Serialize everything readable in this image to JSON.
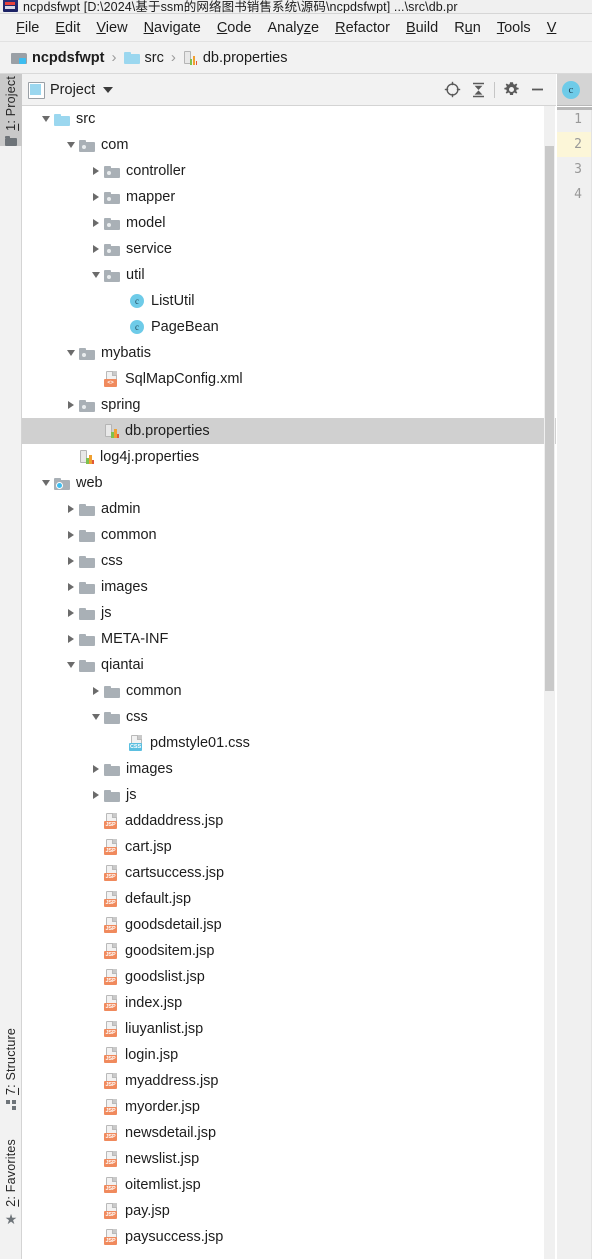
{
  "window": {
    "title": "ncpdsfwpt [D:\\2024\\基于ssm的网络图书销售系统\\源码\\ncpdsfwpt] ...\\src\\db.pr",
    "logo_icon": "intellij-idea-logo"
  },
  "menubar": {
    "items": [
      {
        "label": "File",
        "mnemonic": "F"
      },
      {
        "label": "Edit",
        "mnemonic": "E"
      },
      {
        "label": "View",
        "mnemonic": "V"
      },
      {
        "label": "Navigate",
        "mnemonic": "N"
      },
      {
        "label": "Code",
        "mnemonic": "C"
      },
      {
        "label": "Analyze",
        "mnemonic": "z"
      },
      {
        "label": "Refactor",
        "mnemonic": "R"
      },
      {
        "label": "Build",
        "mnemonic": "B"
      },
      {
        "label": "Run",
        "mnemonic": "u"
      },
      {
        "label": "Tools",
        "mnemonic": "T"
      },
      {
        "label": "V",
        "mnemonic": "V"
      }
    ]
  },
  "breadcrumb": {
    "separator": "›",
    "items": [
      {
        "label": "ncpdsfwpt",
        "icon": "module-icon",
        "bold": true
      },
      {
        "label": "src",
        "icon": "folder-blue-icon",
        "bold": false
      },
      {
        "label": "db.properties",
        "icon": "properties-file-icon",
        "bold": false
      }
    ]
  },
  "left_stripe": {
    "buttons": [
      {
        "label": "1: Project",
        "mnemonic": "1",
        "icon": "project-icon",
        "active": true
      },
      {
        "label": "7: Structure",
        "mnemonic": "7",
        "icon": "structure-icon",
        "active": false
      },
      {
        "label": "2: Favorites",
        "mnemonic": "2",
        "icon": "star-icon",
        "active": false
      }
    ]
  },
  "project_panel": {
    "title": "Project",
    "view_icon": "project-view-icon",
    "dropdown_icon": "chevron-down-icon",
    "toolbar": [
      {
        "name": "locate-icon",
        "tooltip": "Select Opened File"
      },
      {
        "name": "collapse-all-icon",
        "tooltip": "Collapse All"
      },
      {
        "name": "gear-icon",
        "tooltip": "Settings"
      },
      {
        "name": "minimize-icon",
        "tooltip": "Hide"
      }
    ],
    "tree": [
      {
        "label": "src",
        "depth": 1,
        "arrow": "down",
        "icon": "folder-blue-icon",
        "selected": false
      },
      {
        "label": "com",
        "depth": 2,
        "arrow": "down",
        "icon": "package-icon",
        "selected": false
      },
      {
        "label": "controller",
        "depth": 3,
        "arrow": "right",
        "icon": "package-icon",
        "selected": false
      },
      {
        "label": "mapper",
        "depth": 3,
        "arrow": "right",
        "icon": "package-icon",
        "selected": false
      },
      {
        "label": "model",
        "depth": 3,
        "arrow": "right",
        "icon": "package-icon",
        "selected": false
      },
      {
        "label": "service",
        "depth": 3,
        "arrow": "right",
        "icon": "package-icon",
        "selected": false
      },
      {
        "label": "util",
        "depth": 3,
        "arrow": "down",
        "icon": "package-icon",
        "selected": false
      },
      {
        "label": "ListUtil",
        "depth": 4,
        "arrow": "none",
        "icon": "java-class-icon",
        "selected": false
      },
      {
        "label": "PageBean",
        "depth": 4,
        "arrow": "none",
        "icon": "java-class-icon",
        "selected": false
      },
      {
        "label": "mybatis",
        "depth": 2,
        "arrow": "down",
        "icon": "package-icon",
        "selected": false
      },
      {
        "label": "SqlMapConfig.xml",
        "depth": 3,
        "arrow": "none",
        "icon": "xml-file-icon",
        "selected": false
      },
      {
        "label": "spring",
        "depth": 2,
        "arrow": "right",
        "icon": "package-icon",
        "selected": false
      },
      {
        "label": "db.properties",
        "depth": 3,
        "arrow": "none",
        "icon": "properties-file-icon",
        "selected": true
      },
      {
        "label": "log4j.properties",
        "depth": 2,
        "arrow": "none",
        "icon": "properties-file-icon",
        "selected": false
      },
      {
        "label": "web",
        "depth": 1,
        "arrow": "down",
        "icon": "web-root-icon",
        "selected": false
      },
      {
        "label": "admin",
        "depth": 2,
        "arrow": "right",
        "icon": "folder-icon",
        "selected": false
      },
      {
        "label": "common",
        "depth": 2,
        "arrow": "right",
        "icon": "folder-icon",
        "selected": false
      },
      {
        "label": "css",
        "depth": 2,
        "arrow": "right",
        "icon": "folder-icon",
        "selected": false
      },
      {
        "label": "images",
        "depth": 2,
        "arrow": "right",
        "icon": "folder-icon",
        "selected": false
      },
      {
        "label": "js",
        "depth": 2,
        "arrow": "right",
        "icon": "folder-icon",
        "selected": false
      },
      {
        "label": "META-INF",
        "depth": 2,
        "arrow": "right",
        "icon": "folder-icon",
        "selected": false
      },
      {
        "label": "qiantai",
        "depth": 2,
        "arrow": "down",
        "icon": "folder-icon",
        "selected": false
      },
      {
        "label": "common",
        "depth": 3,
        "arrow": "right",
        "icon": "folder-icon",
        "selected": false
      },
      {
        "label": "css",
        "depth": 3,
        "arrow": "down",
        "icon": "folder-icon",
        "selected": false
      },
      {
        "label": "pdmstyle01.css",
        "depth": 4,
        "arrow": "none",
        "icon": "css-file-icon",
        "selected": false
      },
      {
        "label": "images",
        "depth": 3,
        "arrow": "right",
        "icon": "folder-icon",
        "selected": false
      },
      {
        "label": "js",
        "depth": 3,
        "arrow": "right",
        "icon": "folder-icon",
        "selected": false
      },
      {
        "label": "addaddress.jsp",
        "depth": 3,
        "arrow": "none",
        "icon": "jsp-file-icon",
        "selected": false
      },
      {
        "label": "cart.jsp",
        "depth": 3,
        "arrow": "none",
        "icon": "jsp-file-icon",
        "selected": false
      },
      {
        "label": "cartsuccess.jsp",
        "depth": 3,
        "arrow": "none",
        "icon": "jsp-file-icon",
        "selected": false
      },
      {
        "label": "default.jsp",
        "depth": 3,
        "arrow": "none",
        "icon": "jsp-file-icon",
        "selected": false
      },
      {
        "label": "goodsdetail.jsp",
        "depth": 3,
        "arrow": "none",
        "icon": "jsp-file-icon",
        "selected": false
      },
      {
        "label": "goodsitem.jsp",
        "depth": 3,
        "arrow": "none",
        "icon": "jsp-file-icon",
        "selected": false
      },
      {
        "label": "goodslist.jsp",
        "depth": 3,
        "arrow": "none",
        "icon": "jsp-file-icon",
        "selected": false
      },
      {
        "label": "index.jsp",
        "depth": 3,
        "arrow": "none",
        "icon": "jsp-file-icon",
        "selected": false
      },
      {
        "label": "liuyanlist.jsp",
        "depth": 3,
        "arrow": "none",
        "icon": "jsp-file-icon",
        "selected": false
      },
      {
        "label": "login.jsp",
        "depth": 3,
        "arrow": "none",
        "icon": "jsp-file-icon",
        "selected": false
      },
      {
        "label": "myaddress.jsp",
        "depth": 3,
        "arrow": "none",
        "icon": "jsp-file-icon",
        "selected": false
      },
      {
        "label": "myorder.jsp",
        "depth": 3,
        "arrow": "none",
        "icon": "jsp-file-icon",
        "selected": false
      },
      {
        "label": "newsdetail.jsp",
        "depth": 3,
        "arrow": "none",
        "icon": "jsp-file-icon",
        "selected": false
      },
      {
        "label": "newslist.jsp",
        "depth": 3,
        "arrow": "none",
        "icon": "jsp-file-icon",
        "selected": false
      },
      {
        "label": "oitemlist.jsp",
        "depth": 3,
        "arrow": "none",
        "icon": "jsp-file-icon",
        "selected": false
      },
      {
        "label": "pay.jsp",
        "depth": 3,
        "arrow": "none",
        "icon": "jsp-file-icon",
        "selected": false
      },
      {
        "label": "paysuccess.jsp",
        "depth": 3,
        "arrow": "none",
        "icon": "jsp-file-icon",
        "selected": false
      }
    ]
  },
  "editor": {
    "tab_icon": "java-class-icon",
    "tab_icon_letter": "c",
    "line_numbers": [
      "1",
      "2",
      "3",
      "4"
    ],
    "caret_line": 2
  },
  "colors": {
    "selection": "#d0d0d0",
    "caret_row": "#fcf6d8",
    "accent_blue": "#6ecbe8",
    "jsp_badge": "#f08a5d",
    "css_badge": "#5bbfe0",
    "panel_bg": "#f2f2f2"
  }
}
